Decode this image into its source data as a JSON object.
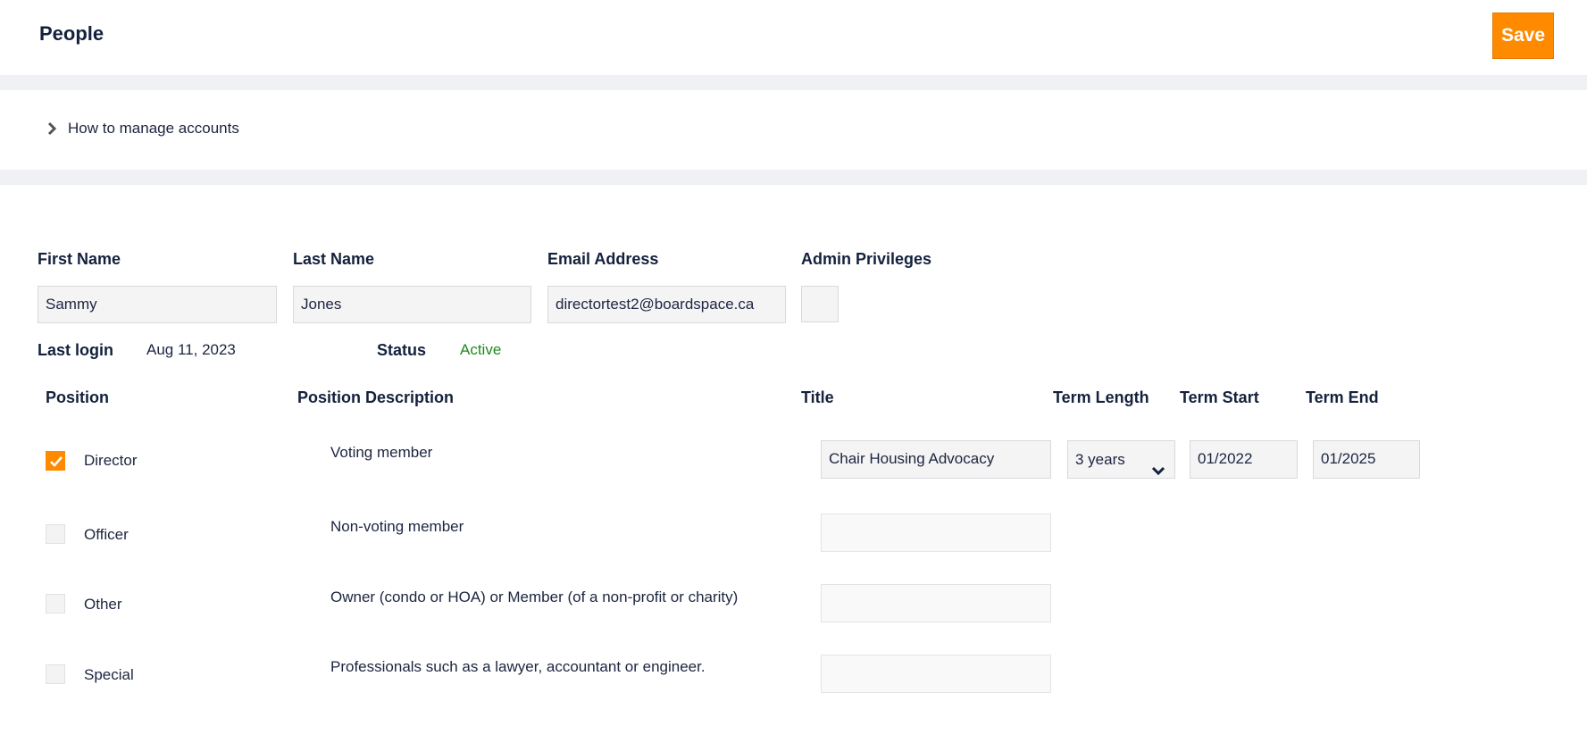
{
  "header": {
    "title": "People",
    "save_label": "Save"
  },
  "help": {
    "label": "How to manage accounts"
  },
  "form": {
    "first_name": {
      "label": "First Name",
      "value": "Sammy"
    },
    "last_name": {
      "label": "Last Name",
      "value": "Jones"
    },
    "email": {
      "label": "Email Address",
      "value": "directortest2@boardspace.ca"
    },
    "admin": {
      "label": "Admin Privileges",
      "checked": false
    },
    "last_login": {
      "label": "Last login",
      "value": "Aug 11, 2023"
    },
    "status": {
      "label": "Status",
      "value": "Active",
      "color": "#1f8a1f"
    }
  },
  "positions_table": {
    "headers": {
      "position": "Position",
      "description": "Position Description",
      "title": "Title",
      "term_length": "Term Length",
      "term_start": "Term Start",
      "term_end": "Term End"
    },
    "rows": [
      {
        "position": "Director",
        "checked": true,
        "description": "Voting member",
        "title": "Chair Housing Advocacy",
        "term_length": "3 years",
        "term_start": "01/2022",
        "term_end": "01/2025"
      },
      {
        "position": "Officer",
        "checked": false,
        "description": "Non-voting member",
        "title": ""
      },
      {
        "position": "Other",
        "checked": false,
        "description": "Owner (condo or HOA) or Member (of a non-profit or charity)",
        "title": ""
      },
      {
        "position": "Special",
        "checked": false,
        "description": "Professionals such as a lawyer, accountant or engineer.",
        "title": ""
      }
    ]
  },
  "colors": {
    "accent": "#ff8a00",
    "heading": "#14213d",
    "band": "#f0f1f5"
  }
}
